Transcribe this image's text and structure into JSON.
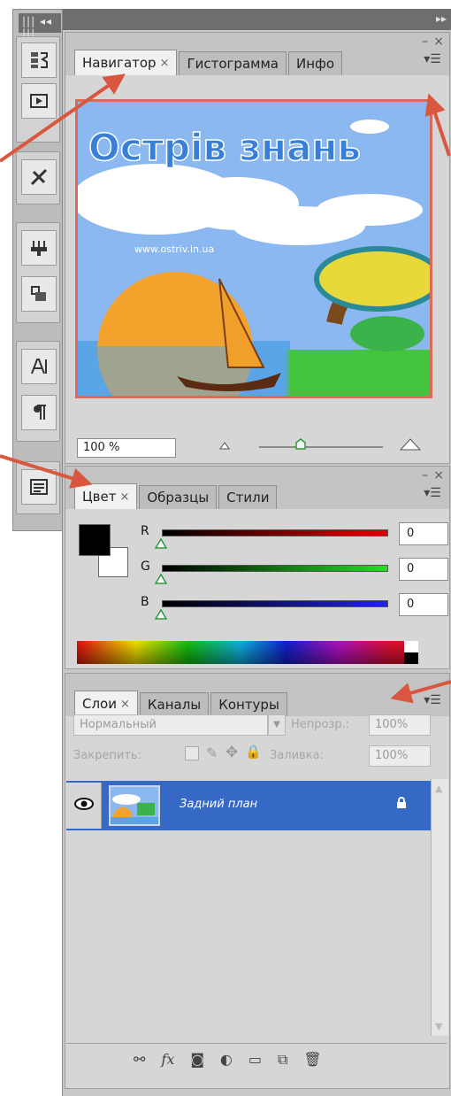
{
  "colors": {
    "accent": "#d9573f",
    "panel_bg": "#d6d6d6",
    "layer_selected": "#3569c5"
  },
  "navigator": {
    "tabs": [
      {
        "label": "Навигатор"
      },
      {
        "label": "Гистограмма"
      },
      {
        "label": "Инфо"
      }
    ],
    "close_glyph": "×",
    "preview": {
      "title": "Острів знань",
      "url": "www.ostriv.in.ua"
    },
    "zoom": "100 %"
  },
  "color": {
    "tabs": [
      {
        "label": "Цвет"
      },
      {
        "label": "Образцы"
      },
      {
        "label": "Стили"
      }
    ],
    "close_glyph": "×",
    "channels": [
      {
        "label": "R",
        "value": "0"
      },
      {
        "label": "G",
        "value": "0"
      },
      {
        "label": "B",
        "value": "0"
      }
    ]
  },
  "layers": {
    "tabs": [
      {
        "label": "Слои"
      },
      {
        "label": "Каналы"
      },
      {
        "label": "Контуры"
      }
    ],
    "close_glyph": "×",
    "blend_mode": "Нормальный",
    "opacity_label": "Непрозр.:",
    "opacity_value": "100%",
    "lock_label": "Закрепить:",
    "fill_label": "Заливка:",
    "fill_value": "100%",
    "layer_name": "Задний план"
  }
}
